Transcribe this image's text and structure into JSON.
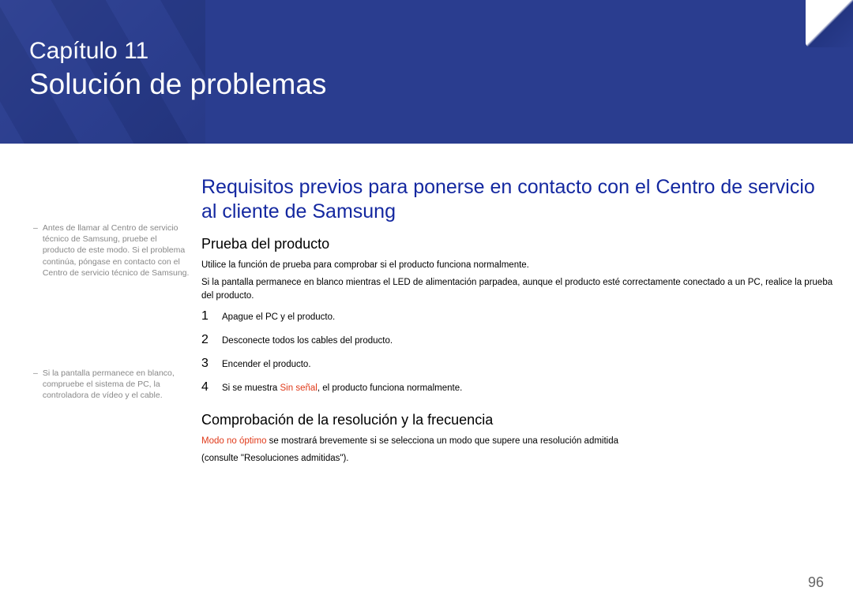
{
  "banner": {
    "chapter_label": "Capítulo 11",
    "chapter_title": "Solución de problemas"
  },
  "main": {
    "section_heading": "Requisitos previos para ponerse en contacto con el Centro de servicio al cliente de Samsung",
    "sub1_heading": "Prueba del producto",
    "p1": "Utilice la función de prueba para comprobar si el producto funciona normalmente.",
    "p2": "Si la pantalla permanece en blanco mientras el LED de alimentación parpadea, aunque el producto esté correctamente conectado a un PC, realice la prueba del producto.",
    "steps": [
      {
        "n": "1",
        "text": "Apague el PC y el producto."
      },
      {
        "n": "2",
        "text": "Desconecte todos los cables del producto."
      },
      {
        "n": "3",
        "text": "Encender el producto."
      },
      {
        "n": "4",
        "prefix": "Si se muestra ",
        "red": "Sin señal",
        "suffix": ", el producto funciona normalmente."
      }
    ],
    "sub2_heading": "Comprobación de la resolución y la frecuencia",
    "p3_red": "Modo no óptimo",
    "p3_rest": " se mostrará brevemente si se selecciona un modo que supere una resolución admitida",
    "p4": "(consulte \"Resoluciones admitidas\")."
  },
  "notes": {
    "n1": "Antes de llamar al Centro de servicio técnico de Samsung, pruebe el producto de este modo. Si el problema continúa, póngase en contacto con el Centro de servicio técnico de Samsung.",
    "n2": "Si la pantalla permanece en blanco, compruebe el sistema de PC, la controladora de vídeo y el cable."
  },
  "page_number": "96"
}
